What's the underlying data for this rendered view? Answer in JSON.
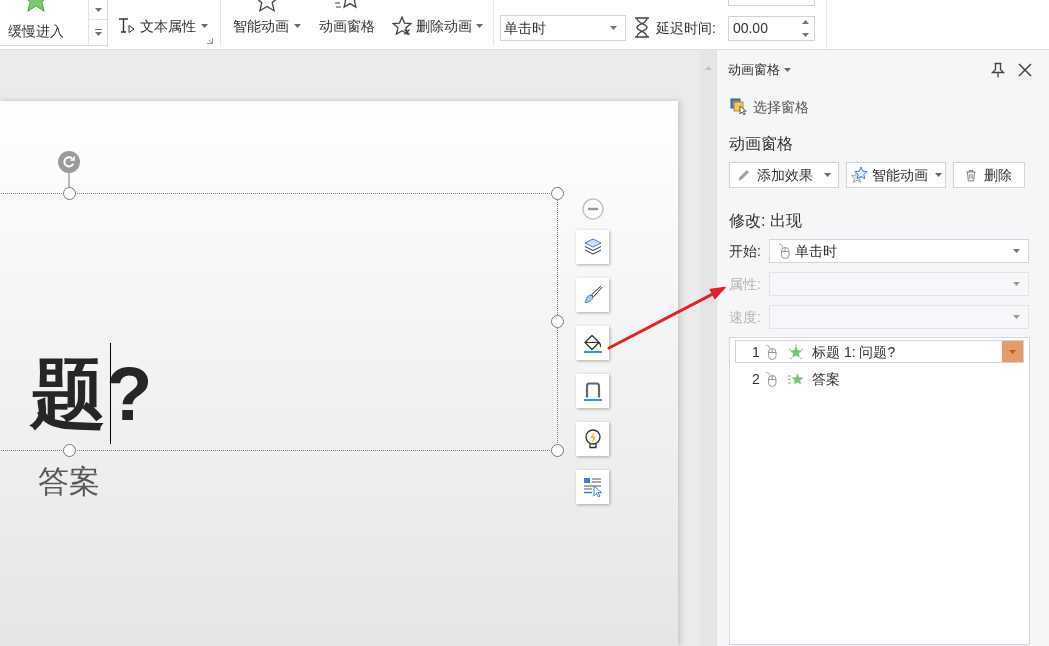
{
  "ribbon": {
    "gallery_item": "缓慢进入",
    "text_properties": {
      "label": "文本属性"
    },
    "buttons": [
      {
        "label": "智能动画",
        "kind": "smart",
        "dropdown": true
      },
      {
        "label": "动画窗格",
        "kind": "pane",
        "dropdown": false
      },
      {
        "label": "删除动画",
        "kind": "delete",
        "dropdown": true
      }
    ],
    "start_select": {
      "value": "单击时"
    },
    "delay": {
      "label": "延迟时间:",
      "value": "00.00"
    }
  },
  "slide": {
    "title": "题?",
    "subtitle": "答案"
  },
  "pane": {
    "title": "动画窗格",
    "select_pane_link": "选择窗格",
    "section_title": "动画窗格",
    "actions": [
      {
        "label": "添加效果",
        "kind": "add",
        "dropdown": true
      },
      {
        "label": "智能动画",
        "kind": "smart",
        "dropdown": true
      },
      {
        "label": "删除",
        "kind": "delete",
        "dropdown": false
      }
    ],
    "modify_title": "修改: 出现",
    "fields": [
      {
        "label": "开始:",
        "value": "单击时",
        "disabled": false
      },
      {
        "label": "属性:",
        "disabled": true
      },
      {
        "label": "速度:",
        "disabled": true
      }
    ],
    "animations": [
      {
        "number": "1",
        "name": "标题 1: 问题?",
        "kind": "burst",
        "selected": true
      },
      {
        "number": "2",
        "name": "答案",
        "kind": "motion",
        "selected": false
      }
    ]
  }
}
